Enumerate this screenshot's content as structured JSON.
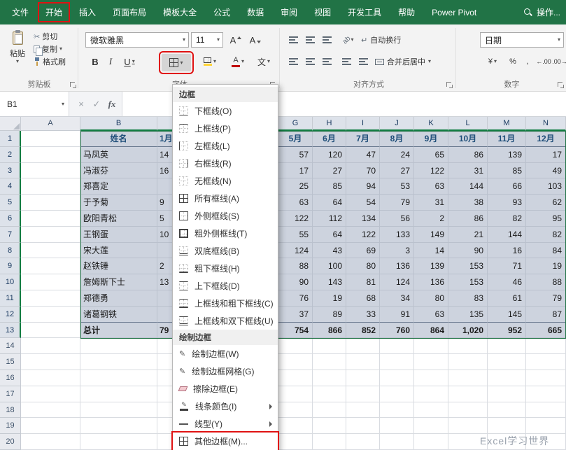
{
  "colors": {
    "excel_green": "#217346",
    "annotation_red": "#e01212",
    "selection_fill": "#cdd3de",
    "header_blue": "#1f4e79",
    "header_accent_green": "#107C41"
  },
  "icons": {
    "caret": "▾",
    "scissors": "✂",
    "pencil": "✎",
    "wrap_return": "↵",
    "cancel": "×",
    "check": "✓",
    "letter_a": "A",
    "orientation": "ab"
  },
  "tabs": {
    "items": [
      {
        "key": "file",
        "label": "文件"
      },
      {
        "key": "home",
        "label": "开始",
        "active": true,
        "annotated": true
      },
      {
        "key": "insert",
        "label": "插入"
      },
      {
        "key": "page-layout",
        "label": "页面布局"
      },
      {
        "key": "template-gallery",
        "label": "模板大全"
      },
      {
        "key": "formulas",
        "label": "公式"
      },
      {
        "key": "data",
        "label": "数据"
      },
      {
        "key": "review",
        "label": "审阅"
      },
      {
        "key": "view",
        "label": "视图"
      },
      {
        "key": "developer",
        "label": "开发工具"
      },
      {
        "key": "help",
        "label": "帮助"
      },
      {
        "key": "power-pivot",
        "label": "Power Pivot"
      }
    ],
    "tellme": "操作..."
  },
  "ribbon": {
    "clipboard": {
      "paste": "粘贴",
      "cut": "剪切",
      "copy": "复制",
      "format_painter": "格式刷",
      "label": "剪贴板"
    },
    "font": {
      "name": "微软雅黑",
      "size": "11",
      "bold": "B",
      "italic": "I",
      "underline": "U",
      "phonetic": "文",
      "label": "字体"
    },
    "alignment": {
      "wrap": "自动换行",
      "merge": "合并后居中",
      "label": "对齐方式"
    },
    "number": {
      "format": "日期",
      "currency": "¥",
      "percent": "%",
      "comma": ",",
      "increase_decimal": "←.00",
      "decrease_decimal": ".00→",
      "label": "数字"
    }
  },
  "formula_bar": {
    "name_box": "B1",
    "fx": "fx"
  },
  "borders_menu": {
    "section_borders": "边框",
    "border_items": [
      {
        "label": "下框线(O)",
        "icon": "border-bottom"
      },
      {
        "label": "上框线(P)",
        "icon": "border-top"
      },
      {
        "label": "左框线(L)",
        "icon": "border-left"
      },
      {
        "label": "右框线(R)",
        "icon": "border-right"
      },
      {
        "label": "无框线(N)",
        "icon": "border-none"
      },
      {
        "label": "所有框线(A)",
        "icon": "border-all"
      },
      {
        "label": "外侧框线(S)",
        "icon": "border-outside"
      },
      {
        "label": "粗外侧框线(T)",
        "icon": "border-thick-outside"
      },
      {
        "label": "双底框线(B)",
        "icon": "border-double-bottom"
      },
      {
        "label": "粗下框线(H)",
        "icon": "border-thick-bottom"
      },
      {
        "label": "上下框线(D)",
        "icon": "border-top-bottom"
      },
      {
        "label": "上框线和粗下框线(C)",
        "icon": "border-top-thick-bottom"
      },
      {
        "label": "上框线和双下框线(U)",
        "icon": "border-top-double-bottom"
      }
    ],
    "section_draw": "绘制边框",
    "draw_items": [
      {
        "label": "绘制边框(W)",
        "icon": "draw-border"
      },
      {
        "label": "绘制边框网格(G)",
        "icon": "draw-border-grid"
      },
      {
        "label": "擦除边框(E)",
        "icon": "erase-border"
      },
      {
        "label": "线条颜色(I)",
        "icon": "line-color",
        "submenu": true
      },
      {
        "label": "线型(Y)",
        "icon": "line-style",
        "submenu": true
      },
      {
        "label": "其他边框(M)...",
        "icon": "more-borders",
        "annotated": true
      }
    ]
  },
  "sheet": {
    "visible_col_letters": [
      "A",
      "B",
      "",
      "G",
      "H",
      "I",
      "J",
      "K",
      "L",
      "M",
      "N"
    ],
    "total_rows": 20,
    "selected_range_rows": 13,
    "table": {
      "header": {
        "name": "姓名",
        "jan_partial": "1月",
        "months": [
          "5月",
          "6月",
          "7月",
          "8月",
          "9月",
          "10月",
          "11月",
          "12月"
        ]
      },
      "rows": [
        {
          "name": "马凤英",
          "jan_partial": "14",
          "values": [
            "57",
            "120",
            "47",
            "24",
            "65",
            "86",
            "139",
            "17"
          ]
        },
        {
          "name": "冯淑芬",
          "jan_partial": "16",
          "values": [
            "17",
            "27",
            "70",
            "27",
            "122",
            "31",
            "85",
            "49"
          ]
        },
        {
          "name": "郑喜定",
          "jan_partial": "",
          "values": [
            "25",
            "85",
            "94",
            "53",
            "63",
            "144",
            "66",
            "103"
          ]
        },
        {
          "name": "于予菊",
          "jan_partial": "9",
          "values": [
            "63",
            "64",
            "54",
            "79",
            "31",
            "38",
            "93",
            "62"
          ]
        },
        {
          "name": "欧阳青松",
          "jan_partial": "5",
          "values": [
            "122",
            "112",
            "134",
            "56",
            "2",
            "86",
            "82",
            "95"
          ]
        },
        {
          "name": "王钢蛋",
          "jan_partial": "10",
          "values": [
            "55",
            "64",
            "122",
            "133",
            "149",
            "21",
            "144",
            "82"
          ]
        },
        {
          "name": "宋大莲",
          "jan_partial": "",
          "values": [
            "124",
            "43",
            "69",
            "3",
            "14",
            "90",
            "16",
            "84"
          ]
        },
        {
          "name": "赵铁锤",
          "jan_partial": "2",
          "values": [
            "88",
            "100",
            "80",
            "136",
            "139",
            "153",
            "71",
            "19"
          ]
        },
        {
          "name": "詹姆斯下士",
          "jan_partial": "13",
          "values": [
            "90",
            "143",
            "81",
            "124",
            "136",
            "153",
            "46",
            "88"
          ]
        },
        {
          "name": "郑德勇",
          "jan_partial": "",
          "values": [
            "76",
            "19",
            "68",
            "34",
            "80",
            "83",
            "61",
            "79"
          ]
        },
        {
          "name": "诸葛钢铁",
          "jan_partial": "",
          "values": [
            "37",
            "89",
            "33",
            "91",
            "63",
            "135",
            "145",
            "87"
          ]
        },
        {
          "name": "总计",
          "jan_partial": "79",
          "is_total": true,
          "values": [
            "754",
            "866",
            "852",
            "760",
            "864",
            "1,020",
            "952",
            "665"
          ]
        }
      ]
    }
  },
  "watermark": "Excel学习世界"
}
